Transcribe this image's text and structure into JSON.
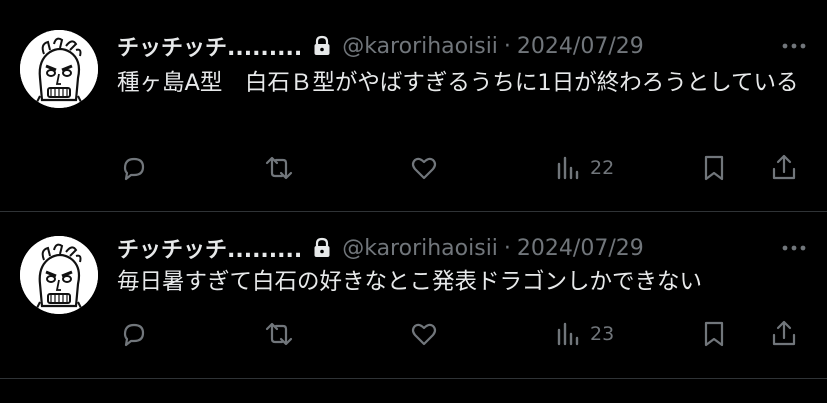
{
  "tweets": [
    {
      "display_name": "チッチッチ.........",
      "handle": "@karorihaoisii",
      "separator": "·",
      "date": "2024/07/29",
      "text": "種ヶ島A型　白石Ｂ型がやばすぎるうちに1日が終わろうとしている",
      "views": "22"
    },
    {
      "display_name": "チッチッチ.........",
      "handle": "@karorihaoisii",
      "separator": "·",
      "date": "2024/07/29",
      "text": "毎日暑すぎて白石の好きなとこ発表ドラゴンしかできない",
      "views": "23"
    }
  ],
  "icons": {
    "lock": "lock-icon",
    "more": "more-icon",
    "reply": "reply-icon",
    "retweet": "retweet-icon",
    "like": "like-icon",
    "views": "views-icon",
    "bookmark": "bookmark-icon",
    "share": "share-icon"
  },
  "colors": {
    "background": "#000000",
    "text_primary": "#e7e9ea",
    "text_secondary": "#71767b",
    "divider": "#2f3336"
  }
}
